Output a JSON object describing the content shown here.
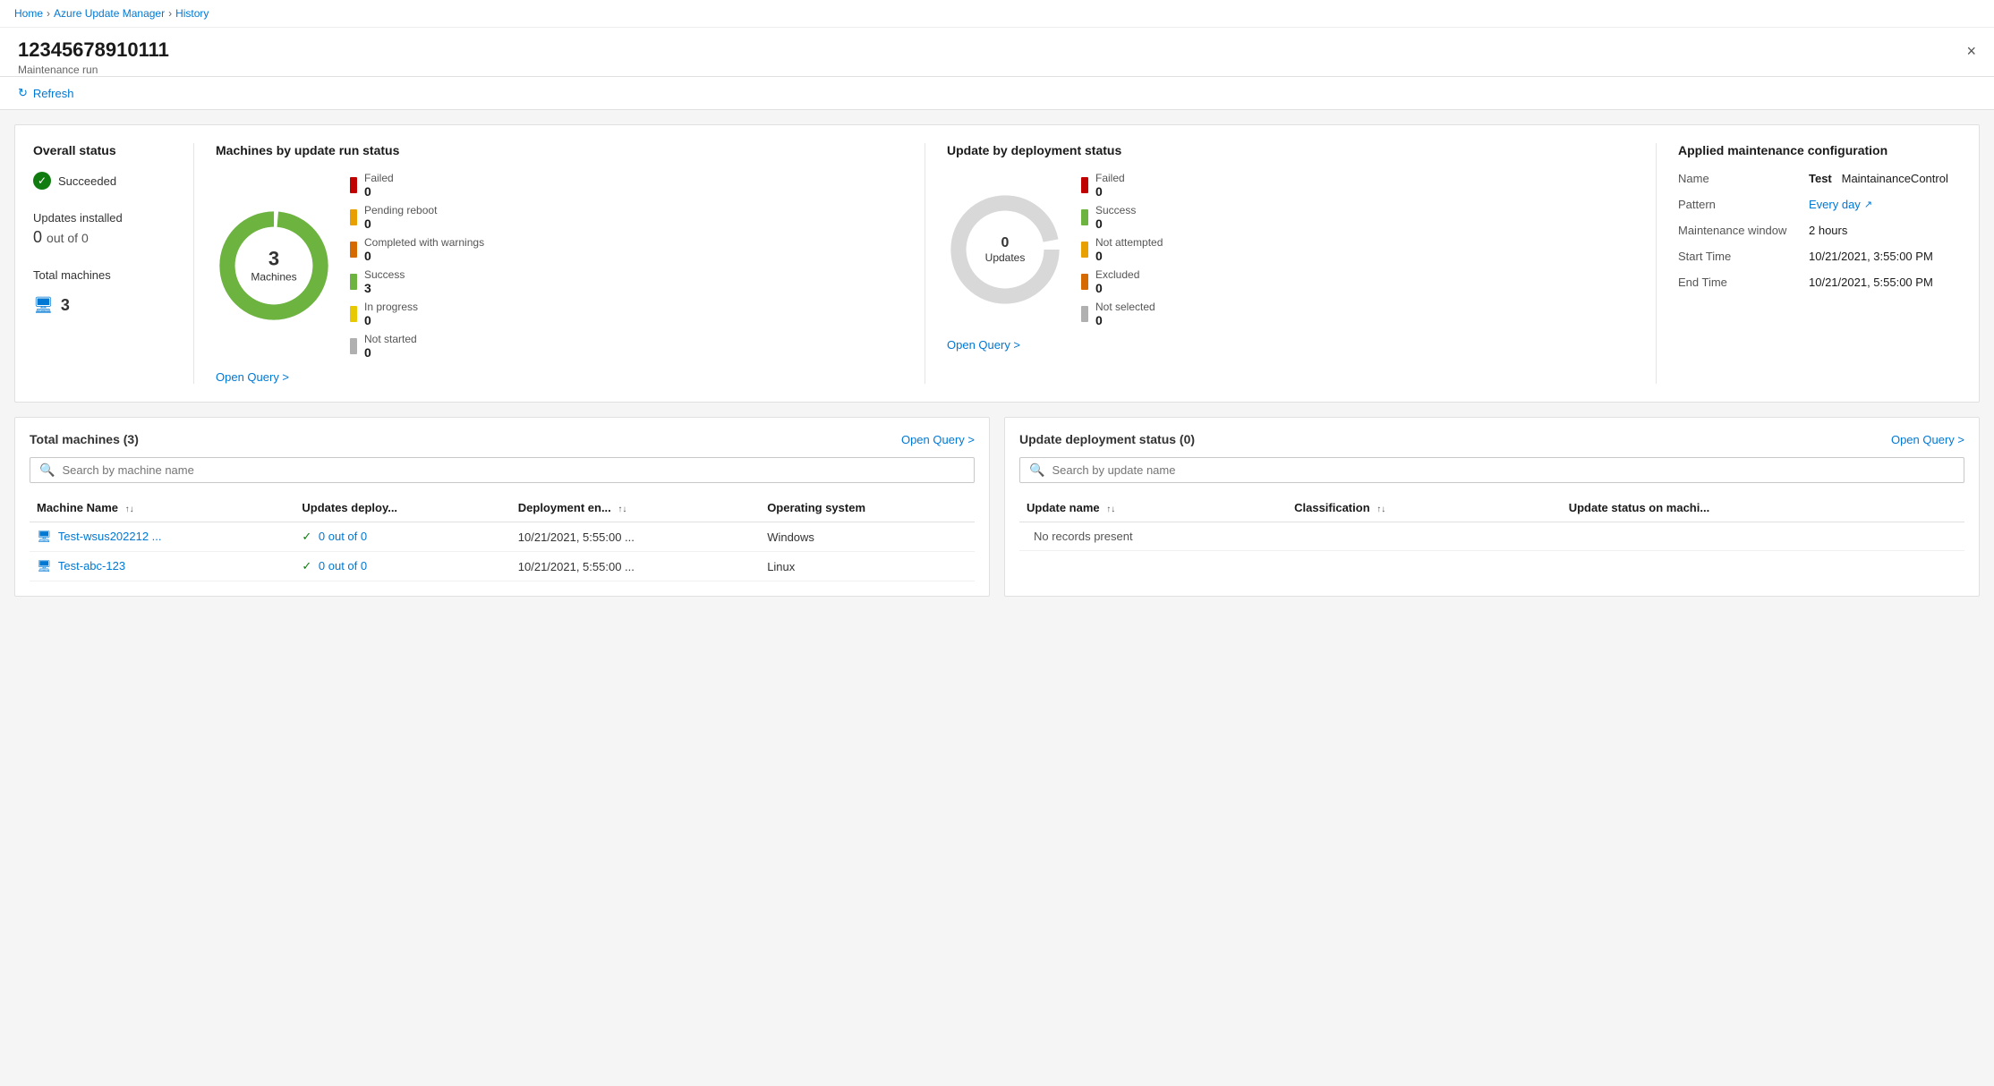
{
  "breadcrumb": {
    "home": "Home",
    "azure_update_manager": "Azure Update Manager",
    "separator": ">",
    "history": "History"
  },
  "header": {
    "title": "12345678910111",
    "subtitle": "Maintenance run",
    "close_label": "×"
  },
  "toolbar": {
    "refresh_label": "Refresh"
  },
  "page_title": "Azure Update Manager History",
  "overall_status": {
    "title": "Overall status",
    "status": "Succeeded",
    "updates_installed_label": "Updates installed",
    "updates_value": "0",
    "updates_out_of": "out of 0",
    "total_machines_label": "Total machines",
    "total_machines_value": "3"
  },
  "machines_chart": {
    "title": "Machines by update run status",
    "center_value": "3",
    "center_label": "Machines",
    "legend": [
      {
        "label": "Failed",
        "value": "0",
        "color": "#c00000"
      },
      {
        "label": "Pending reboot",
        "value": "0",
        "color": "#e8a000"
      },
      {
        "label": "Completed with warnings",
        "value": "0",
        "color": "#d46a00"
      },
      {
        "label": "Success",
        "value": "3",
        "color": "#6db33f"
      },
      {
        "label": "In progress",
        "value": "0",
        "color": "#e8c800"
      },
      {
        "label": "Not started",
        "value": "0",
        "color": "#b0b0b0"
      }
    ],
    "open_query": "Open Query >"
  },
  "updates_chart": {
    "title": "Update by deployment status",
    "center_value": "0",
    "center_label": "Updates",
    "legend": [
      {
        "label": "Failed",
        "value": "0",
        "color": "#c00000"
      },
      {
        "label": "Success",
        "value": "0",
        "color": "#6db33f"
      },
      {
        "label": "Not attempted",
        "value": "0",
        "color": "#e8a000"
      },
      {
        "label": "Excluded",
        "value": "0",
        "color": "#d46a00"
      },
      {
        "label": "Not selected",
        "value": "0",
        "color": "#b0b0b0"
      }
    ],
    "open_query": "Open Query >"
  },
  "config": {
    "title": "Applied maintenance configuration",
    "name_label": "Name",
    "name_prefix": "Test",
    "name_value": "MaintainanceControl",
    "pattern_label": "Pattern",
    "pattern_value": "Every day",
    "maintenance_window_label": "Maintenance window",
    "maintenance_window_value": "2 hours",
    "start_time_label": "Start Time",
    "start_time_value": "10/21/2021, 3:55:00 PM",
    "end_time_label": "End Time",
    "end_time_value": "10/21/2021, 5:55:00 PM"
  },
  "total_machines_table": {
    "title": "Total machines (3)",
    "open_query": "Open Query >",
    "search_placeholder": "Search by machine name",
    "columns": [
      "Machine Name",
      "Updates deploy...",
      "Deployment en...",
      "Operating system"
    ],
    "rows": [
      {
        "machine_name": "Test-wsus202212 ...",
        "updates_deployed": "0 out of 0",
        "deployment_end": "10/21/2021, 5:55:00 ...",
        "os": "Windows"
      },
      {
        "machine_name": "Test-abc-123",
        "updates_deployed": "0 out of 0",
        "deployment_end": "10/21/2021, 5:55:00 ...",
        "os": "Linux"
      }
    ]
  },
  "update_deployment_table": {
    "title": "Update deployment status (0)",
    "open_query": "Open Query >",
    "search_placeholder": "Search by update name",
    "columns": [
      "Update name",
      "Classification",
      "Update status on machi..."
    ],
    "no_records": "No records present"
  }
}
